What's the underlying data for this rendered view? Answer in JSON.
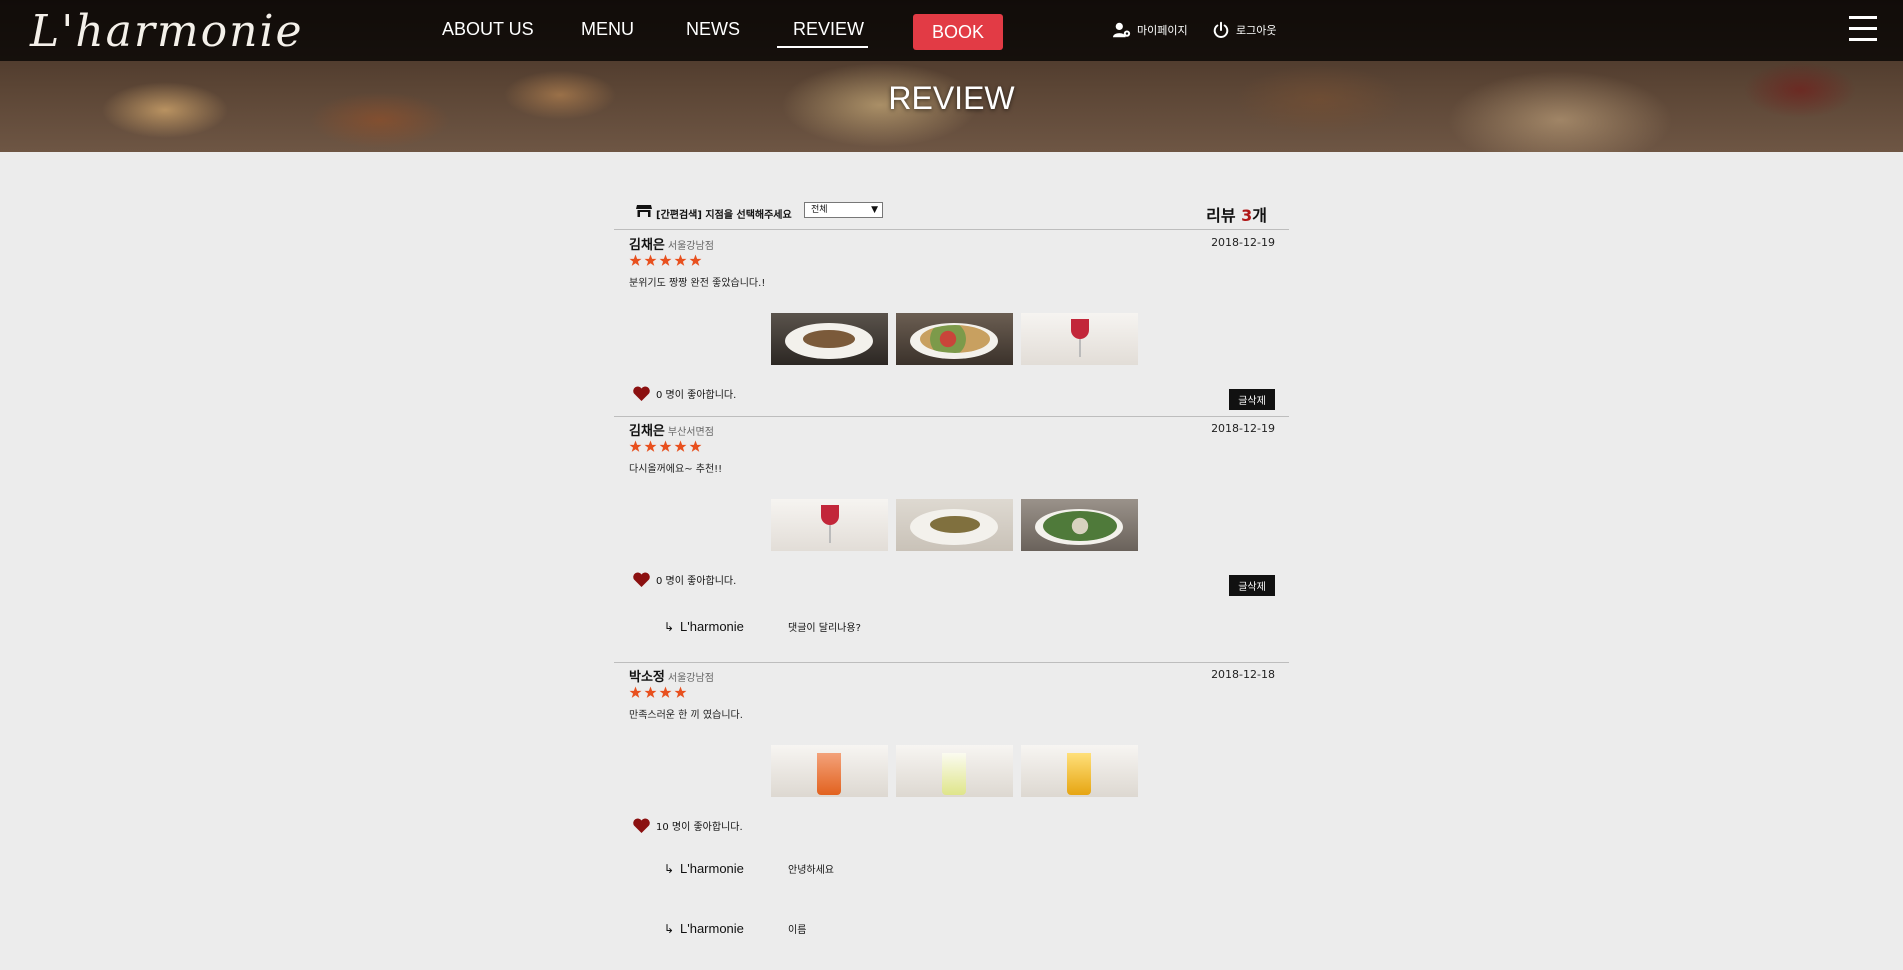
{
  "header": {
    "logo": "L'harmonie",
    "nav": [
      "ABOUT US",
      "MENU",
      "NEWS",
      "REVIEW"
    ],
    "book_label": "BOOK",
    "mypage_label": "마이페이지",
    "logout_label": "로그아웃",
    "page_title": "REVIEW"
  },
  "filter": {
    "label": "[간편검색] 지점을 선택해주세요",
    "selected_branch": "전체",
    "count_prefix": "리뷰 ",
    "count": "3",
    "count_suffix": "개"
  },
  "reviews": [
    {
      "author": "김채은",
      "branch": "서울강남점",
      "date": "2018-12-19",
      "rating": 5,
      "text": "분위기도 짱짱 완전 좋았습니다.!",
      "likes_text": "0 명이 좋아합니다.",
      "delete_label": "글삭제",
      "replies": []
    },
    {
      "author": "김채은",
      "branch": "부산서면점",
      "date": "2018-12-19",
      "rating": 5,
      "text": "다시올꺼에요~ 추천!!",
      "likes_text": "0 명이 좋아합니다.",
      "delete_label": "글삭제",
      "replies": [
        {
          "name": "L'harmonie",
          "text": "댓글이 달리나용?"
        }
      ]
    },
    {
      "author": "박소정",
      "branch": "서울강남점",
      "date": "2018-12-18",
      "rating": 4,
      "text": "만족스러운 한 끼 였습니다.",
      "likes_text": "10 명이 좋아합니다.",
      "replies": [
        {
          "name": "L'harmonie",
          "text": "안녕하세요"
        },
        {
          "name": "L'harmonie",
          "text": "이름"
        }
      ]
    }
  ],
  "colors": {
    "book": "#e23b45",
    "star": "#e8501e",
    "heart": "#8b1010",
    "count": "#b01818"
  }
}
